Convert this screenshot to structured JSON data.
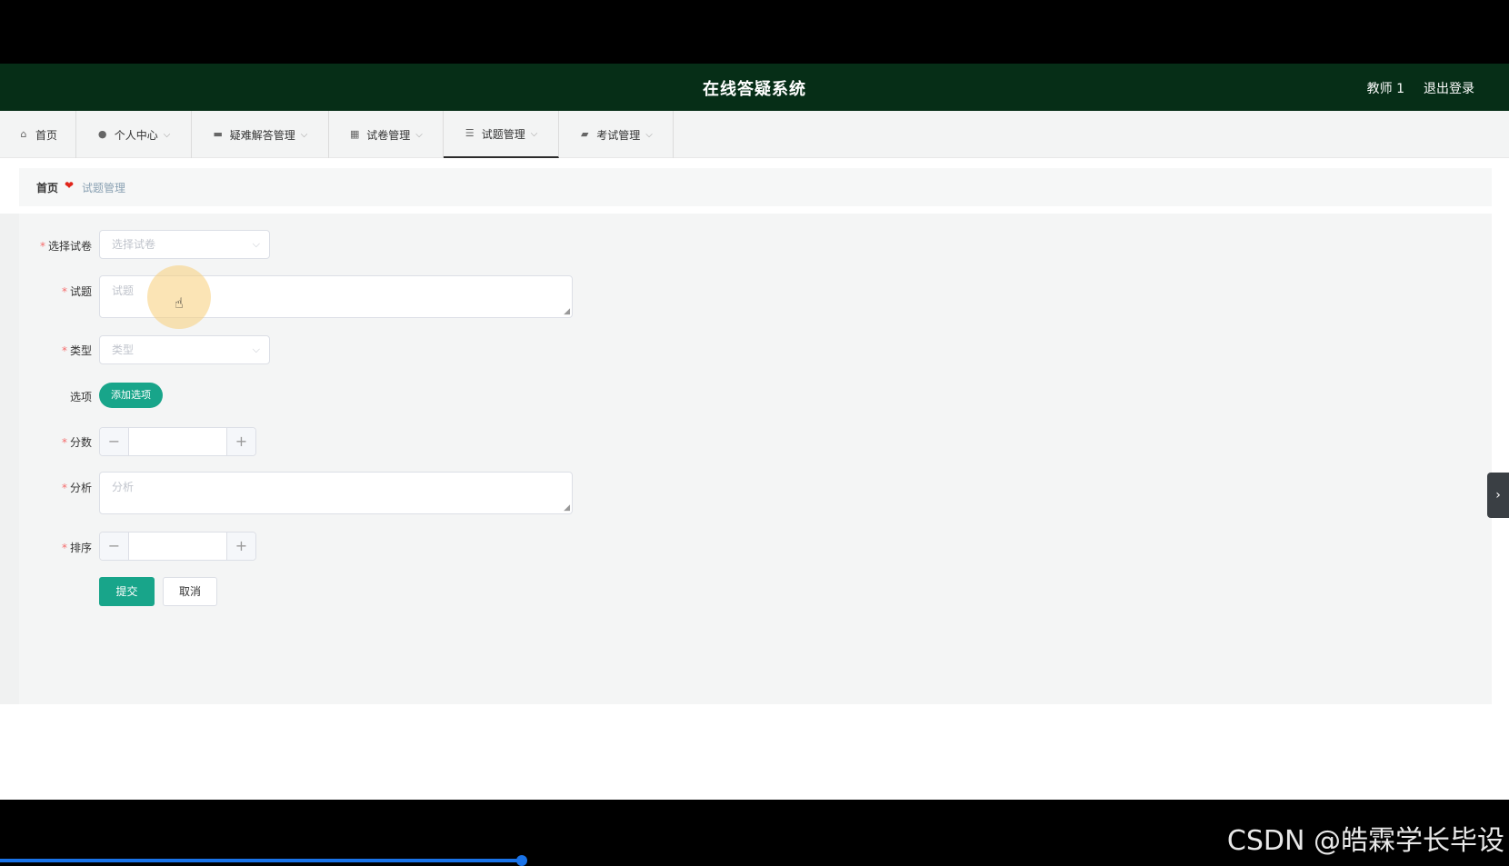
{
  "header": {
    "title": "在线答疑系统",
    "user": "教师 1",
    "logout": "退出登录"
  },
  "nav": {
    "items": [
      {
        "label": "首页",
        "icon": "home-icon",
        "dropdown": false
      },
      {
        "label": "个人中心",
        "icon": "user-icon",
        "dropdown": true
      },
      {
        "label": "疑难解答管理",
        "icon": "ticket-icon",
        "dropdown": true
      },
      {
        "label": "试卷管理",
        "icon": "grid-icon",
        "dropdown": true
      },
      {
        "label": "试题管理",
        "icon": "list-icon",
        "dropdown": true,
        "active": true
      },
      {
        "label": "考试管理",
        "icon": "briefcase-icon",
        "dropdown": true
      }
    ]
  },
  "breadcrumb": {
    "home": "首页",
    "current": "试题管理"
  },
  "form": {
    "paper": {
      "label": "选择试卷",
      "placeholder": "选择试卷",
      "required": true
    },
    "question": {
      "label": "试题",
      "placeholder": "试题",
      "required": true
    },
    "type": {
      "label": "类型",
      "placeholder": "类型",
      "required": true
    },
    "options": {
      "label": "选项",
      "add_label": "添加选项"
    },
    "score": {
      "label": "分数",
      "value": "",
      "required": true
    },
    "analysis": {
      "label": "分析",
      "placeholder": "分析",
      "required": true
    },
    "order": {
      "label": "排序",
      "value": "",
      "required": true
    },
    "submit_label": "提交",
    "cancel_label": "取消"
  },
  "watermark": "CSDN @皓霖学长毕设",
  "colors": {
    "header_bg": "#062e17",
    "accent": "#18a58a",
    "required": "#f56c6c"
  }
}
